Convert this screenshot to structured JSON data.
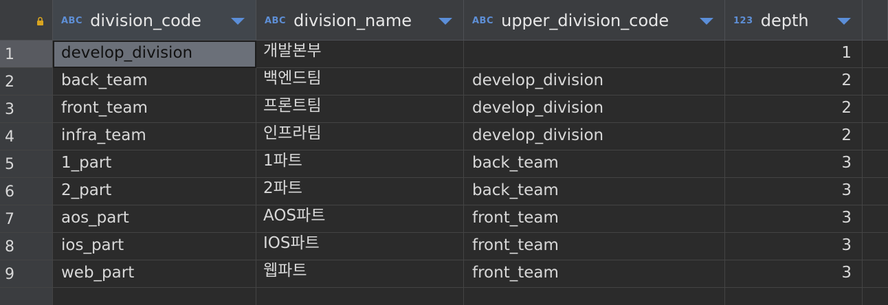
{
  "table": {
    "columns": [
      {
        "type": "ABC",
        "name": "division_code"
      },
      {
        "type": "ABC",
        "name": "division_name"
      },
      {
        "type": "ABC",
        "name": "upper_division_code"
      },
      {
        "type": "123",
        "name": "depth"
      }
    ],
    "rows": [
      {
        "num": "1",
        "division_code": "develop_division",
        "division_name": "개발본부",
        "upper_division_code": "",
        "depth": "1"
      },
      {
        "num": "2",
        "division_code": "back_team",
        "division_name": "백엔드팀",
        "upper_division_code": "develop_division",
        "depth": "2"
      },
      {
        "num": "3",
        "division_code": "front_team",
        "division_name": "프론트팀",
        "upper_division_code": "develop_division",
        "depth": "2"
      },
      {
        "num": "4",
        "division_code": "infra_team",
        "division_name": "인프라팀",
        "upper_division_code": "develop_division",
        "depth": "2"
      },
      {
        "num": "5",
        "division_code": "1_part",
        "division_name": "1파트",
        "upper_division_code": "back_team",
        "depth": "3"
      },
      {
        "num": "6",
        "division_code": "2_part",
        "division_name": "2파트",
        "upper_division_code": "back_team",
        "depth": "3"
      },
      {
        "num": "7",
        "division_code": "aos_part",
        "division_name": "AOS파트",
        "upper_division_code": "front_team",
        "depth": "3"
      },
      {
        "num": "8",
        "division_code": "ios_part",
        "division_name": "IOS파트",
        "upper_division_code": "front_team",
        "depth": "3"
      },
      {
        "num": "9",
        "division_code": "web_part",
        "division_name": "웹파트",
        "upper_division_code": "front_team",
        "depth": "3"
      }
    ]
  },
  "icons": {
    "lock": "lock-icon",
    "sort": "sort-arrow-icon"
  },
  "colors": {
    "type_badge": "#5e8fd6",
    "sort_arrow": "#5b8ed8",
    "lock": "#d9a520"
  }
}
